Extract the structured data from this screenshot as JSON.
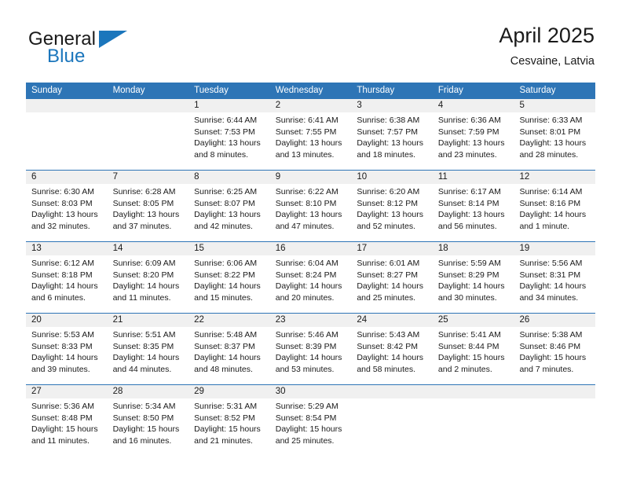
{
  "brand": {
    "word_one": "General",
    "word_two": "Blue",
    "flag_icon": "triangle-flag-icon",
    "accent_color": "#1b76bc"
  },
  "header": {
    "title": "April 2025",
    "subtitle": "Cesvaine, Latvia"
  },
  "theme": {
    "header_blue": "#2e75b6",
    "row_gray": "#f0f0f0",
    "text": "#1a1a1a"
  },
  "weekdays": [
    "Sunday",
    "Monday",
    "Tuesday",
    "Wednesday",
    "Thursday",
    "Friday",
    "Saturday"
  ],
  "weeks": [
    {
      "days": [
        {
          "num": "",
          "lines": [
            "",
            "",
            "",
            ""
          ]
        },
        {
          "num": "",
          "lines": [
            "",
            "",
            "",
            ""
          ]
        },
        {
          "num": "1",
          "lines": [
            "Sunrise: 6:44 AM",
            "Sunset: 7:53 PM",
            "Daylight: 13 hours",
            "and 8 minutes."
          ]
        },
        {
          "num": "2",
          "lines": [
            "Sunrise: 6:41 AM",
            "Sunset: 7:55 PM",
            "Daylight: 13 hours",
            "and 13 minutes."
          ]
        },
        {
          "num": "3",
          "lines": [
            "Sunrise: 6:38 AM",
            "Sunset: 7:57 PM",
            "Daylight: 13 hours",
            "and 18 minutes."
          ]
        },
        {
          "num": "4",
          "lines": [
            "Sunrise: 6:36 AM",
            "Sunset: 7:59 PM",
            "Daylight: 13 hours",
            "and 23 minutes."
          ]
        },
        {
          "num": "5",
          "lines": [
            "Sunrise: 6:33 AM",
            "Sunset: 8:01 PM",
            "Daylight: 13 hours",
            "and 28 minutes."
          ]
        }
      ]
    },
    {
      "days": [
        {
          "num": "6",
          "lines": [
            "Sunrise: 6:30 AM",
            "Sunset: 8:03 PM",
            "Daylight: 13 hours",
            "and 32 minutes."
          ]
        },
        {
          "num": "7",
          "lines": [
            "Sunrise: 6:28 AM",
            "Sunset: 8:05 PM",
            "Daylight: 13 hours",
            "and 37 minutes."
          ]
        },
        {
          "num": "8",
          "lines": [
            "Sunrise: 6:25 AM",
            "Sunset: 8:07 PM",
            "Daylight: 13 hours",
            "and 42 minutes."
          ]
        },
        {
          "num": "9",
          "lines": [
            "Sunrise: 6:22 AM",
            "Sunset: 8:10 PM",
            "Daylight: 13 hours",
            "and 47 minutes."
          ]
        },
        {
          "num": "10",
          "lines": [
            "Sunrise: 6:20 AM",
            "Sunset: 8:12 PM",
            "Daylight: 13 hours",
            "and 52 minutes."
          ]
        },
        {
          "num": "11",
          "lines": [
            "Sunrise: 6:17 AM",
            "Sunset: 8:14 PM",
            "Daylight: 13 hours",
            "and 56 minutes."
          ]
        },
        {
          "num": "12",
          "lines": [
            "Sunrise: 6:14 AM",
            "Sunset: 8:16 PM",
            "Daylight: 14 hours",
            "and 1 minute."
          ]
        }
      ]
    },
    {
      "days": [
        {
          "num": "13",
          "lines": [
            "Sunrise: 6:12 AM",
            "Sunset: 8:18 PM",
            "Daylight: 14 hours",
            "and 6 minutes."
          ]
        },
        {
          "num": "14",
          "lines": [
            "Sunrise: 6:09 AM",
            "Sunset: 8:20 PM",
            "Daylight: 14 hours",
            "and 11 minutes."
          ]
        },
        {
          "num": "15",
          "lines": [
            "Sunrise: 6:06 AM",
            "Sunset: 8:22 PM",
            "Daylight: 14 hours",
            "and 15 minutes."
          ]
        },
        {
          "num": "16",
          "lines": [
            "Sunrise: 6:04 AM",
            "Sunset: 8:24 PM",
            "Daylight: 14 hours",
            "and 20 minutes."
          ]
        },
        {
          "num": "17",
          "lines": [
            "Sunrise: 6:01 AM",
            "Sunset: 8:27 PM",
            "Daylight: 14 hours",
            "and 25 minutes."
          ]
        },
        {
          "num": "18",
          "lines": [
            "Sunrise: 5:59 AM",
            "Sunset: 8:29 PM",
            "Daylight: 14 hours",
            "and 30 minutes."
          ]
        },
        {
          "num": "19",
          "lines": [
            "Sunrise: 5:56 AM",
            "Sunset: 8:31 PM",
            "Daylight: 14 hours",
            "and 34 minutes."
          ]
        }
      ]
    },
    {
      "days": [
        {
          "num": "20",
          "lines": [
            "Sunrise: 5:53 AM",
            "Sunset: 8:33 PM",
            "Daylight: 14 hours",
            "and 39 minutes."
          ]
        },
        {
          "num": "21",
          "lines": [
            "Sunrise: 5:51 AM",
            "Sunset: 8:35 PM",
            "Daylight: 14 hours",
            "and 44 minutes."
          ]
        },
        {
          "num": "22",
          "lines": [
            "Sunrise: 5:48 AM",
            "Sunset: 8:37 PM",
            "Daylight: 14 hours",
            "and 48 minutes."
          ]
        },
        {
          "num": "23",
          "lines": [
            "Sunrise: 5:46 AM",
            "Sunset: 8:39 PM",
            "Daylight: 14 hours",
            "and 53 minutes."
          ]
        },
        {
          "num": "24",
          "lines": [
            "Sunrise: 5:43 AM",
            "Sunset: 8:42 PM",
            "Daylight: 14 hours",
            "and 58 minutes."
          ]
        },
        {
          "num": "25",
          "lines": [
            "Sunrise: 5:41 AM",
            "Sunset: 8:44 PM",
            "Daylight: 15 hours",
            "and 2 minutes."
          ]
        },
        {
          "num": "26",
          "lines": [
            "Sunrise: 5:38 AM",
            "Sunset: 8:46 PM",
            "Daylight: 15 hours",
            "and 7 minutes."
          ]
        }
      ]
    },
    {
      "days": [
        {
          "num": "27",
          "lines": [
            "Sunrise: 5:36 AM",
            "Sunset: 8:48 PM",
            "Daylight: 15 hours",
            "and 11 minutes."
          ]
        },
        {
          "num": "28",
          "lines": [
            "Sunrise: 5:34 AM",
            "Sunset: 8:50 PM",
            "Daylight: 15 hours",
            "and 16 minutes."
          ]
        },
        {
          "num": "29",
          "lines": [
            "Sunrise: 5:31 AM",
            "Sunset: 8:52 PM",
            "Daylight: 15 hours",
            "and 21 minutes."
          ]
        },
        {
          "num": "30",
          "lines": [
            "Sunrise: 5:29 AM",
            "Sunset: 8:54 PM",
            "Daylight: 15 hours",
            "and 25 minutes."
          ]
        },
        {
          "num": "",
          "lines": [
            "",
            "",
            "",
            ""
          ]
        },
        {
          "num": "",
          "lines": [
            "",
            "",
            "",
            ""
          ]
        },
        {
          "num": "",
          "lines": [
            "",
            "",
            "",
            ""
          ]
        }
      ]
    }
  ]
}
